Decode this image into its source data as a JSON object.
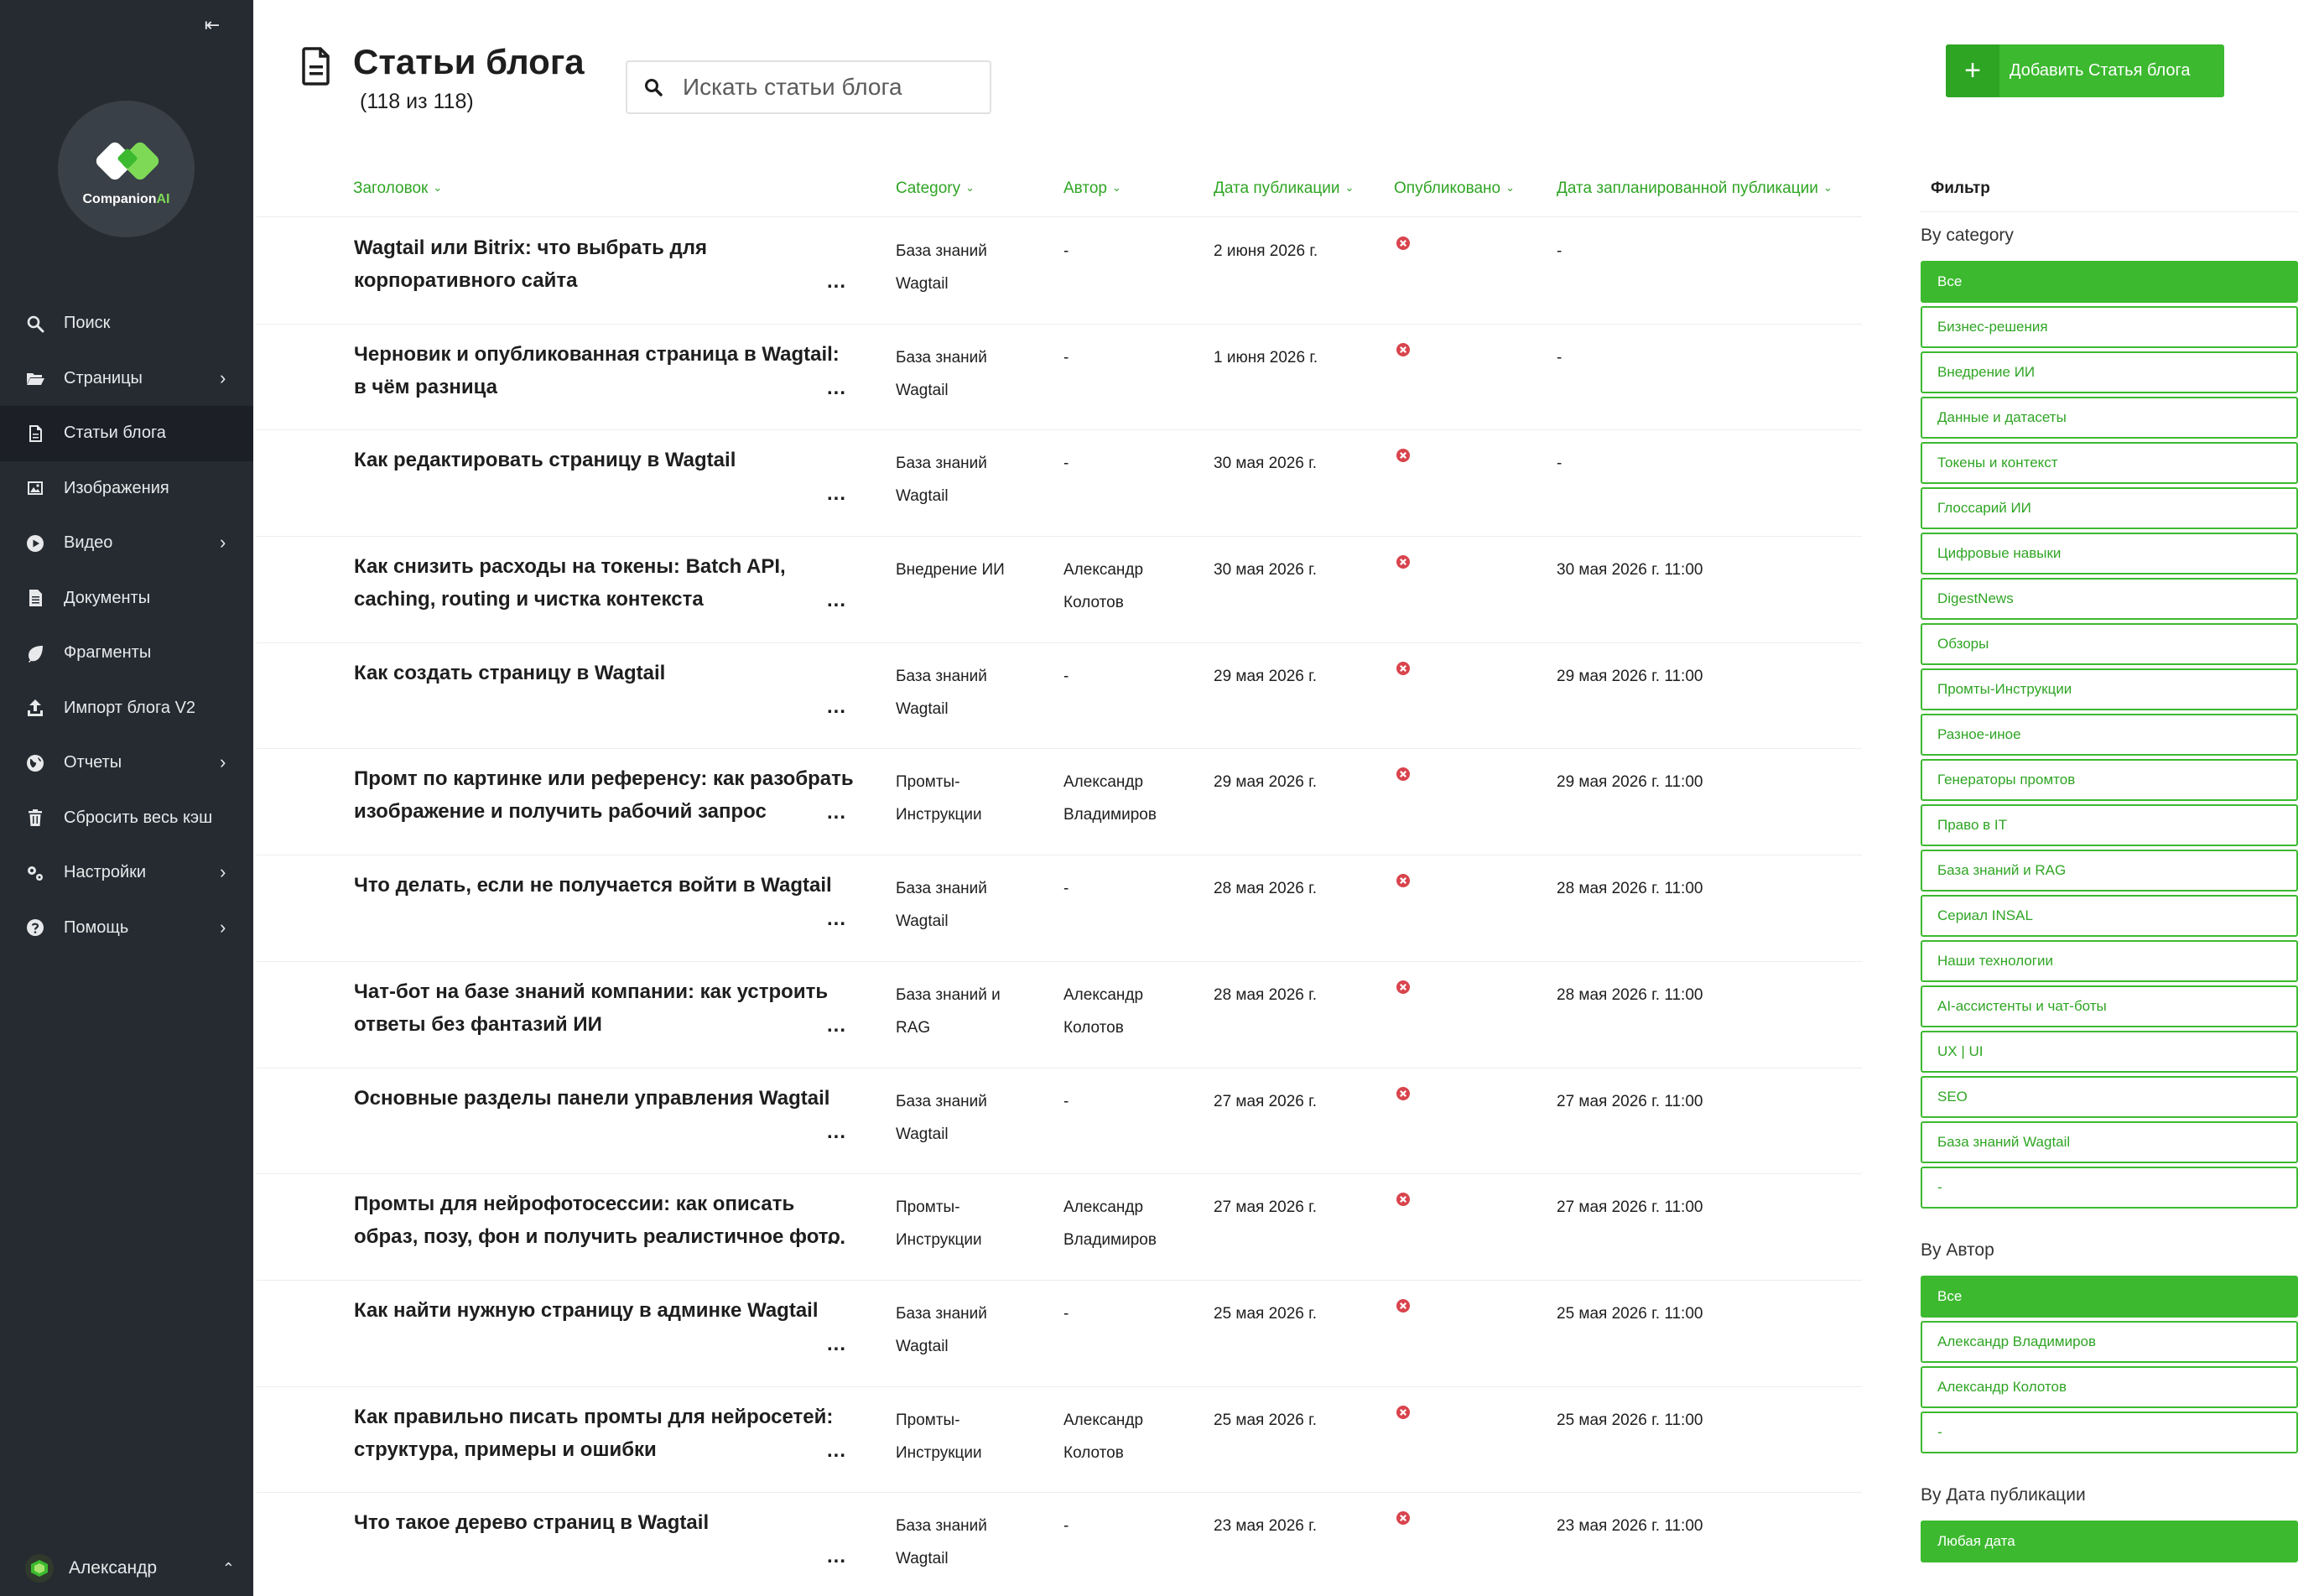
{
  "sidebar": {
    "logo_text_1": "Companion",
    "logo_text_2": "AI",
    "collapse_icon": "collapse-left-icon",
    "items": [
      {
        "label": "Поиск",
        "icon": "search-icon",
        "chevron": false,
        "active": false
      },
      {
        "label": "Страницы",
        "icon": "folder-open-icon",
        "chevron": true,
        "active": false
      },
      {
        "label": "Статьи блога",
        "icon": "document-icon",
        "chevron": false,
        "active": true
      },
      {
        "label": "Изображения",
        "icon": "image-icon",
        "chevron": false,
        "active": false
      },
      {
        "label": "Видео",
        "icon": "play-circle-icon",
        "chevron": true,
        "active": false
      },
      {
        "label": "Документы",
        "icon": "doc-icon",
        "chevron": false,
        "active": false
      },
      {
        "label": "Фрагменты",
        "icon": "leaf-icon",
        "chevron": false,
        "active": false
      },
      {
        "label": "Импорт блога V2",
        "icon": "upload-icon",
        "chevron": false,
        "active": false
      },
      {
        "label": "Отчеты",
        "icon": "globe-icon",
        "chevron": true,
        "active": false
      },
      {
        "label": "Сбросить весь кэш",
        "icon": "trash-icon",
        "chevron": false,
        "active": false
      },
      {
        "label": "Настройки",
        "icon": "cogs-icon",
        "chevron": true,
        "active": false
      },
      {
        "label": "Помощь",
        "icon": "help-icon",
        "chevron": true,
        "active": false
      }
    ],
    "user_name": "Александр"
  },
  "header": {
    "title": "Статьи блога",
    "count": "(118 из 118)",
    "search_placeholder": "Искать статьи блога",
    "add_label": "Добавить Статья блога"
  },
  "table": {
    "columns": {
      "title": "Заголовок",
      "category": "Category",
      "author": "Автор",
      "pub_date": "Дата публикации",
      "published": "Опубликовано",
      "scheduled": "Дата запланированной публикации"
    },
    "more_label": "...",
    "rows": [
      {
        "title": "Wagtail или Bitrix: что выбрать для корпоративного сайта",
        "category": "База знаний Wagtail",
        "author": "-",
        "date": "2 июня 2026 г.",
        "scheduled": "-"
      },
      {
        "title": "Черновик и опубликованная страница в Wagtail: в чём разница",
        "category": "База знаний Wagtail",
        "author": "-",
        "date": "1 июня 2026 г.",
        "scheduled": "-"
      },
      {
        "title": "Как редактировать страницу в Wagtail",
        "category": "База знаний Wagtail",
        "author": "-",
        "date": "30 мая 2026 г.",
        "scheduled": "-"
      },
      {
        "title": "Как снизить расходы на токены: Batch API, caching, routing и чистка контекста",
        "category": "Внедрение ИИ",
        "author": "Александр Колотов",
        "date": "30 мая 2026 г.",
        "scheduled": "30 мая 2026 г. 11:00"
      },
      {
        "title": "Как создать страницу в Wagtail",
        "category": "База знаний Wagtail",
        "author": "-",
        "date": "29 мая 2026 г.",
        "scheduled": "29 мая 2026 г. 11:00"
      },
      {
        "title": "Промт по картинке или референсу: как разобрать изображение и получить рабочий запрос",
        "category": "Промты-Инструкции",
        "author": "Александр Владимиров",
        "date": "29 мая 2026 г.",
        "scheduled": "29 мая 2026 г. 11:00"
      },
      {
        "title": "Что делать, если не получается войти в Wagtail",
        "category": "База знаний Wagtail",
        "author": "-",
        "date": "28 мая 2026 г.",
        "scheduled": "28 мая 2026 г. 11:00"
      },
      {
        "title": "Чат-бот на базе знаний компании: как устроить ответы без фантазий ИИ",
        "category": "База знаний и RAG",
        "author": "Александр Колотов",
        "date": "28 мая 2026 г.",
        "scheduled": "28 мая 2026 г. 11:00"
      },
      {
        "title": "Основные разделы панели управления Wagtail",
        "category": "База знаний Wagtail",
        "author": "-",
        "date": "27 мая 2026 г.",
        "scheduled": "27 мая 2026 г. 11:00"
      },
      {
        "title": "Промты для нейрофотосессии: как описать образ, позу, фон и получить реалистичное фото",
        "category": "Промты-Инструкции",
        "author": "Александр Владимиров",
        "date": "27 мая 2026 г.",
        "scheduled": "27 мая 2026 г. 11:00"
      },
      {
        "title": "Как найти нужную страницу в админке Wagtail",
        "category": "База знаний Wagtail",
        "author": "-",
        "date": "25 мая 2026 г.",
        "scheduled": "25 мая 2026 г. 11:00"
      },
      {
        "title": "Как правильно писать промты для нейросетей: структура, примеры и ошибки",
        "category": "Промты-Инструкции",
        "author": "Александр Колотов",
        "date": "25 мая 2026 г.",
        "scheduled": "25 мая 2026 г. 11:00"
      },
      {
        "title": "Что такое дерево страниц в Wagtail",
        "category": "База знаний Wagtail",
        "author": "-",
        "date": "23 мая 2026 г.",
        "scheduled": "23 мая 2026 г. 11:00"
      }
    ]
  },
  "filter": {
    "title": "Фильтр",
    "category_label": "By category",
    "categories": [
      "Все",
      "Бизнес-решения",
      "Внедрение ИИ",
      "Данные и датасеты",
      "Токены и контекст",
      "Глоссарий ИИ",
      "Цифровые навыки",
      "DigestNews",
      "Обзоры",
      "Промты-Инструкции",
      "Разное-иное",
      "Генераторы промтов",
      "Право в IT",
      "База знаний и RAG",
      "Сериал INSAL",
      "Наши технологии",
      "AI-ассистенты и чат-боты",
      "UX | UI",
      "SEO",
      "База знаний Wagtail",
      "-"
    ],
    "author_label": "By Автор",
    "authors": [
      "Все",
      "Александр Владимиров",
      "Александр Колотов",
      "-"
    ],
    "date_label": "By Дата публикации",
    "dates": [
      "Любая дата"
    ]
  },
  "colors": {
    "accent": "#3cb92f",
    "sidebar_bg": "#262b31",
    "unpublished_icon": "#d9444d"
  }
}
